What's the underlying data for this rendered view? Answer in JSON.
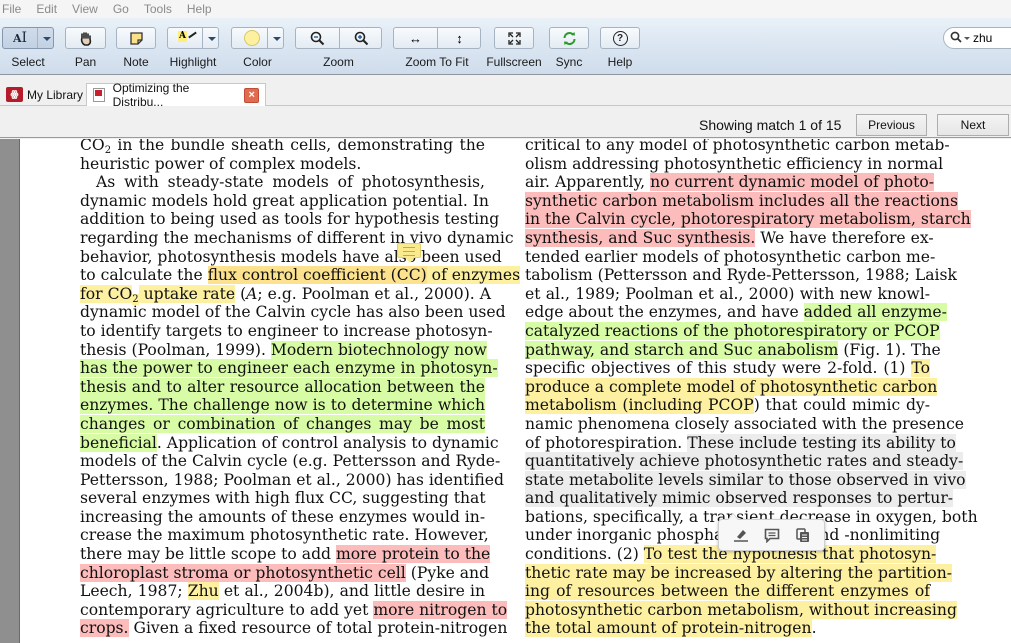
{
  "menu": [
    "File",
    "Edit",
    "View",
    "Go",
    "Tools",
    "Help"
  ],
  "toolbar": {
    "select": "Select",
    "pan": "Pan",
    "note": "Note",
    "highlight": "Highlight",
    "color": "Color",
    "zoom": "Zoom",
    "zoom_to_fit": "Zoom To Fit",
    "fullscreen": "Fullscreen",
    "sync": "Sync",
    "help": "Help",
    "highlight_color": "#fdf0a0",
    "sync_color": "#2a9a2a"
  },
  "search": {
    "value": "zhu"
  },
  "tabs": {
    "library": "My Library",
    "document": "Optimizing the Distribu..."
  },
  "findbar": {
    "status": "Showing match 1 of 15",
    "previous": "Previous",
    "next": "Next"
  },
  "page": {
    "left": [
      [
        "CO",
        "2",
        " in the bundle sheath cells, demonstrating the"
      ],
      [
        "heuristic power of complex models."
      ],
      [
        "As with steady-state models of photosynthesis,"
      ],
      [
        "dynamic models hold great application potential. In"
      ],
      [
        "addition to being used as tools for hypothesis testing"
      ],
      [
        "regarding the mechanisms of different in vivo dynamic"
      ],
      [
        "behavior, photosynthesis models have also been used"
      ],
      [
        "to calculate the ",
        "flux control coefficient (CC)",
        " of enzymes"
      ],
      [
        "for CO",
        "2",
        " uptake rate",
        " (",
        "A",
        "; e.g. Poolman et al., 2000). A"
      ],
      [
        "dynamic model of the Calvin cycle has also been used"
      ],
      [
        "to identify targets to engineer to increase photosyn-"
      ],
      [
        "thesis (Poolman, 1999). ",
        "Modern biotechnology now"
      ],
      [
        "has the power to engineer each enzyme in photosyn-"
      ],
      [
        "thesis and to alter resource allocation between the"
      ],
      [
        "enzymes. The challenge now is to determine which"
      ],
      [
        "changes or combination of changes may be most"
      ],
      [
        "beneficial",
        ". Application of control analysis to dynamic"
      ],
      [
        "models of the Calvin cycle (e.g. Pettersson and Ryde-"
      ],
      [
        "Pettersson, 1988; Poolman et al., 2000) has identified"
      ],
      [
        "several enzymes with high flux CC, suggesting that"
      ],
      [
        "increasing the amounts of these enzymes would in-"
      ],
      [
        "crease the maximum photosynthetic rate. However,"
      ],
      [
        "there may be little scope to add ",
        "more protein to the"
      ],
      [
        "chloroplast stroma or photosynthetic cell",
        " (Pyke and"
      ],
      [
        "Leech, 1987; ",
        "Zhu",
        " et al., 2004b), and little desire in"
      ],
      [
        "contemporary agriculture to add yet ",
        "more nitrogen to"
      ],
      [
        "crops.",
        " Given a fixed resource of total protein-nitrogen"
      ]
    ],
    "right": [
      [
        "critical to any model of photosynthetic carbon metab-"
      ],
      [
        "olism addressing photosynthetic efficiency in normal"
      ],
      [
        "air. Apparently, ",
        "no current dynamic model of photo-"
      ],
      [
        "synthetic carbon metabolism includes all the reactions"
      ],
      [
        "in the Calvin cycle, photorespiratory metabolism, starch"
      ],
      [
        "synthesis, and Suc synthesis.",
        " We have therefore ex-"
      ],
      [
        "tended earlier models of photosynthetic carbon me-"
      ],
      [
        "tabolism (Pettersson and Ryde-Pettersson, 1988; Laisk"
      ],
      [
        "et al., 1989; Poolman et al., 2000) with new knowl-"
      ],
      [
        "edge about the enzymes, and have ",
        "added all enzyme-"
      ],
      [
        "catalyzed reactions of the photorespiratory or PCOP"
      ],
      [
        "pathway, and starch and Suc anabolism",
        " (Fig. 1). The"
      ],
      [
        "specific objectives of this study were 2-fold. (1) ",
        "To"
      ],
      [
        "produce a complete model of photosynthetic carbon"
      ],
      [
        "metabolism (including PCOP",
        ") that could mimic dy-"
      ],
      [
        "namic phenomena closely associated with the presence"
      ],
      [
        "of photorespiration. ",
        "These include testing its ability to"
      ],
      [
        "quantitatively achieve photosynthetic rates and steady-"
      ],
      [
        "state metabolite levels similar to those observed in vivo"
      ],
      [
        "and qualitatively mimic observed responses to pertur-"
      ],
      [
        "bations, specifically, a transient decrease in oxygen, both"
      ],
      [
        "under inorganic phosphate-limiting and -nonlimiting"
      ],
      [
        "conditions. (2) ",
        "To test the hypothesis that photosyn-"
      ],
      [
        "thetic rate may be increased by altering the partition-"
      ],
      [
        "ing of resources between the different enzymes of"
      ],
      [
        "photosynthetic carbon metabolism, without increasing"
      ],
      [
        "the total amount of protein-nitrogen",
        "."
      ]
    ]
  },
  "popup": {
    "highlight": "highlight-icon",
    "comment": "comment-icon",
    "copy": "copy-icon"
  }
}
